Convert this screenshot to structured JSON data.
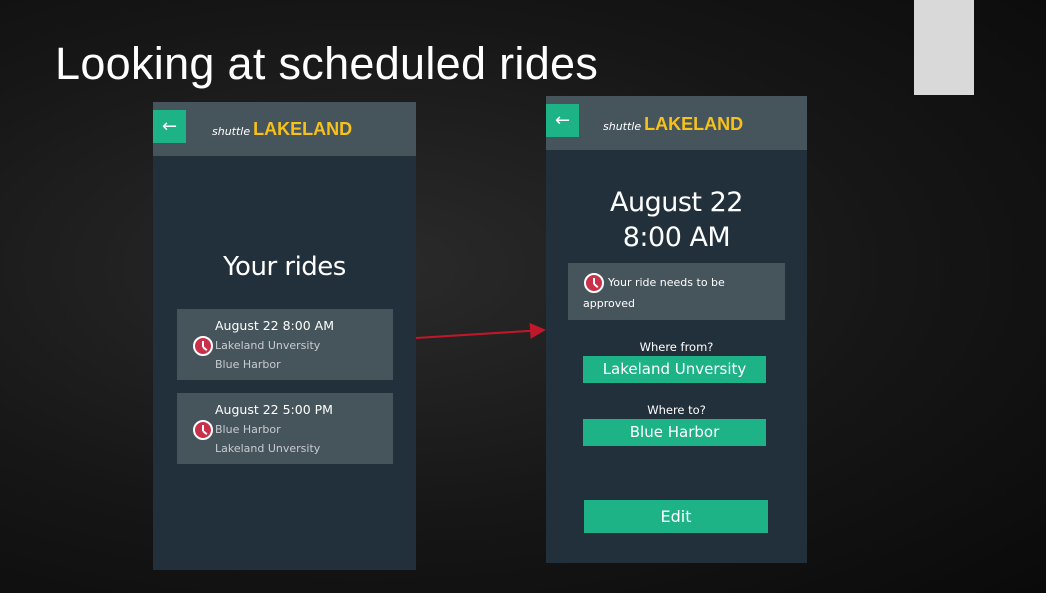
{
  "slide": {
    "title": "Looking at scheduled rides"
  },
  "brand": {
    "small": "shuttle",
    "big": "LAKELAND"
  },
  "icons": {
    "back": "arrow-left-icon",
    "status": "clock-icon"
  },
  "colors": {
    "accent": "#1db386",
    "brand": "#f6c21a",
    "status": "#c9314a",
    "connector": "#c0182a"
  },
  "list_screen": {
    "heading": "Your rides",
    "rides": [
      {
        "when": "August 22 8:00 AM",
        "from": "Lakeland Unversity",
        "to": "Blue Harbor"
      },
      {
        "when": "August 22 5:00 PM",
        "from": "Blue Harbor",
        "to": "Lakeland Unversity"
      }
    ]
  },
  "detail_screen": {
    "date": "August 22",
    "time": "8:00 AM",
    "status_line1": "Your ride needs to be",
    "status_line2": "approved",
    "from_label": "Where from?",
    "from_value": "Lakeland Unversity",
    "to_label": "Where to?",
    "to_value": "Blue Harbor",
    "edit_label": "Edit"
  }
}
